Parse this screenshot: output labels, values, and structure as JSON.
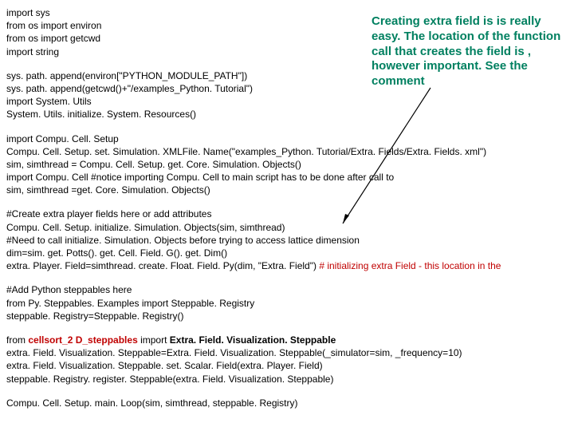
{
  "callout": "Creating extra field is is really easy. The location of the function call that creates the field is , however important. See the comment",
  "c1_l1": "import sys",
  "c1_l2": "from os import environ",
  "c1_l3": "from os import getcwd",
  "c1_l4": "import string",
  "c2_l1": "sys. path. append(environ[\"PYTHON_MODULE_PATH\"])",
  "c2_l2": "sys. path. append(getcwd()+\"/examples_Python. Tutorial\")",
  "c2_l3": "import System. Utils",
  "c2_l4": "System. Utils. initialize. System. Resources()",
  "c3_l1": "import Compu. Cell. Setup",
  "c3_l2": "Compu. Cell. Setup. set. Simulation. XMLFile. Name(\"examples_Python. Tutorial/Extra. Fields/Extra. Fields. xml\")",
  "c3_l3": "sim, simthread = Compu. Cell. Setup. get. Core. Simulation. Objects()",
  "c3_l4": "import Compu. Cell #notice importing Compu. Cell to main script has to be done after call to",
  "c3_l5": "sim, simthread =get. Core. Simulation. Objects()",
  "c4_l1": "#Create extra player fields here or add attributes",
  "c4_l2": "Compu. Cell. Setup. initialize. Simulation. Objects(sim, simthread)",
  "c4_l3": "#Need to call initialize. Simulation. Objects before trying to access lattice dimension",
  "c4_l4": "dim=sim. get. Potts(). get. Cell. Field. G(). get. Dim()",
  "c4_l5a": "extra. Player. Field=simthread. create. Float. Field. Py(dim, \"Extra. Field\") ",
  "c4_l5b": "# initializing extra Field - this location in the",
  "c5_l1": "#Add Python steppables here",
  "c5_l2": "from Py. Steppables. Examples import Steppable. Registry",
  "c5_l3": "steppable. Registry=Steppable. Registry()",
  "c6_l1a": "from ",
  "c6_l1b": "cellsort_2 D_steppables",
  "c6_l1c": " import ",
  "c6_l1d": "Extra. Field. Visualization. Steppable",
  "c6_l2": "extra. Field. Visualization. Steppable=Extra. Field. Visualization. Steppable(_simulator=sim, _frequency=10)",
  "c6_l3": "extra. Field. Visualization. Steppable. set. Scalar. Field(extra. Player. Field)",
  "c6_l4": "steppable. Registry. register. Steppable(extra. Field. Visualization. Steppable)",
  "c7_l1": "Compu. Cell. Setup. main. Loop(sim, simthread, steppable. Registry)"
}
